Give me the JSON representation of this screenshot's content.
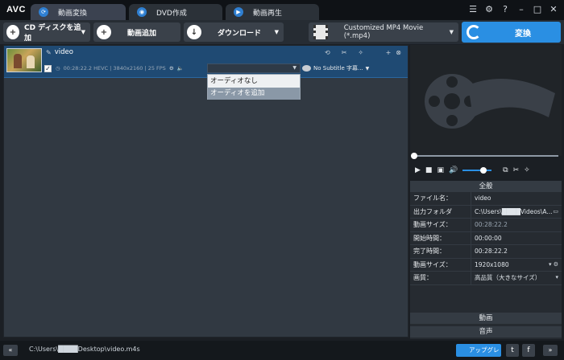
{
  "app": {
    "logo": "AVC"
  },
  "tabs": [
    {
      "label": "動画変換",
      "icon": "convert-icon"
    },
    {
      "label": "DVD作成",
      "icon": "disc-icon"
    },
    {
      "label": "動画再生",
      "icon": "play-icon"
    }
  ],
  "window_icons": [
    "list-icon",
    "gear-icon",
    "help-icon",
    "minimize-icon",
    "maximize-icon",
    "close-icon"
  ],
  "toolbar": {
    "cd_label": "CD ディスクを追加",
    "add_video_label": "動画追加",
    "download_label": "ダウンロード",
    "format_value": "Customized MP4 Movie (*.mp4)",
    "convert_label": "変換"
  },
  "file": {
    "name": "video",
    "duration": "00:28:22.2",
    "codec": "HEVC",
    "resolution": "3840x2160",
    "fps": "25 FPS",
    "subtitle": "No Subtitle 字幕...",
    "meta_text": "00:28:22.2   HEVC | 3840x2160 | 25 FPS"
  },
  "audio_dropdown": {
    "options": [
      "オーディオなし",
      "オーディオを追加"
    ],
    "highlighted_index": 1
  },
  "player": {
    "seek_position": 0.0,
    "volume_level": 0.65
  },
  "props": {
    "general_header": "全般",
    "rows": [
      {
        "key": "ファイル名：",
        "value": "video"
      },
      {
        "key": "出力フォルダ",
        "value": "C:\\Users\\████Videos\\A..."
      },
      {
        "key": "動画サイズ：",
        "value": "00:28:22.2"
      },
      {
        "key": "開始時間：",
        "value": "00:00:00"
      },
      {
        "key": "完了時間：",
        "value": "00:28:22.2"
      },
      {
        "key": "動画サイズ：",
        "value": "1920x1080"
      },
      {
        "key": "画質：",
        "value": "高品質（大きなサイズ）"
      }
    ],
    "video_header": "動画",
    "audio_header": "音声"
  },
  "status": {
    "path": "C:\\Users\\████Desktop\\video.m4s",
    "upgrade_label": "アップグレ"
  },
  "colors": {
    "accent": "#2a8fe3",
    "selected_row": "#1f4a73",
    "background": "#313942"
  }
}
